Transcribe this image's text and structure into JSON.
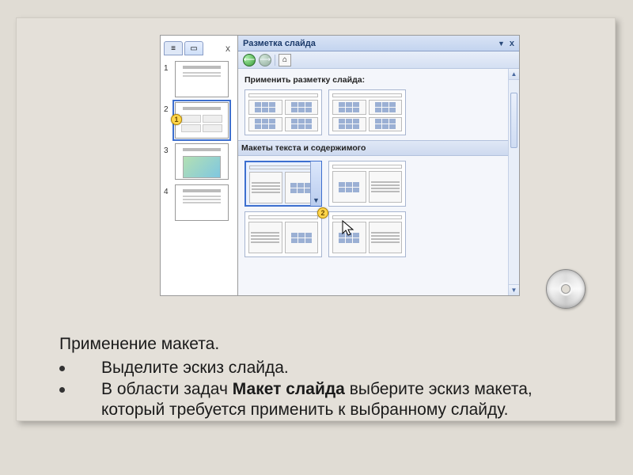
{
  "slide": {
    "heading": "Применение макета.",
    "bullet1": "Выделите эскиз слайда.",
    "bullet2_part1": "В области задач ",
    "bullet2_bold": "Макет слайда",
    "bullet2_part2": " выберите эскиз макета, который требуется применить к выбранному слайду."
  },
  "taskpane": {
    "title": "Разметка слайда",
    "apply_label": "Применить разметку слайда:",
    "section2": "Макеты текста и содержимого"
  },
  "thumbs": {
    "nums": [
      "1",
      "2",
      "3",
      "4"
    ]
  },
  "badges": {
    "one": "1",
    "two": "2"
  },
  "glyphs": {
    "close": "x",
    "dropdown": "▼",
    "back": "⟵",
    "fwd": "⟶",
    "home": "⌂",
    "up": "▲",
    "down": "▼"
  }
}
